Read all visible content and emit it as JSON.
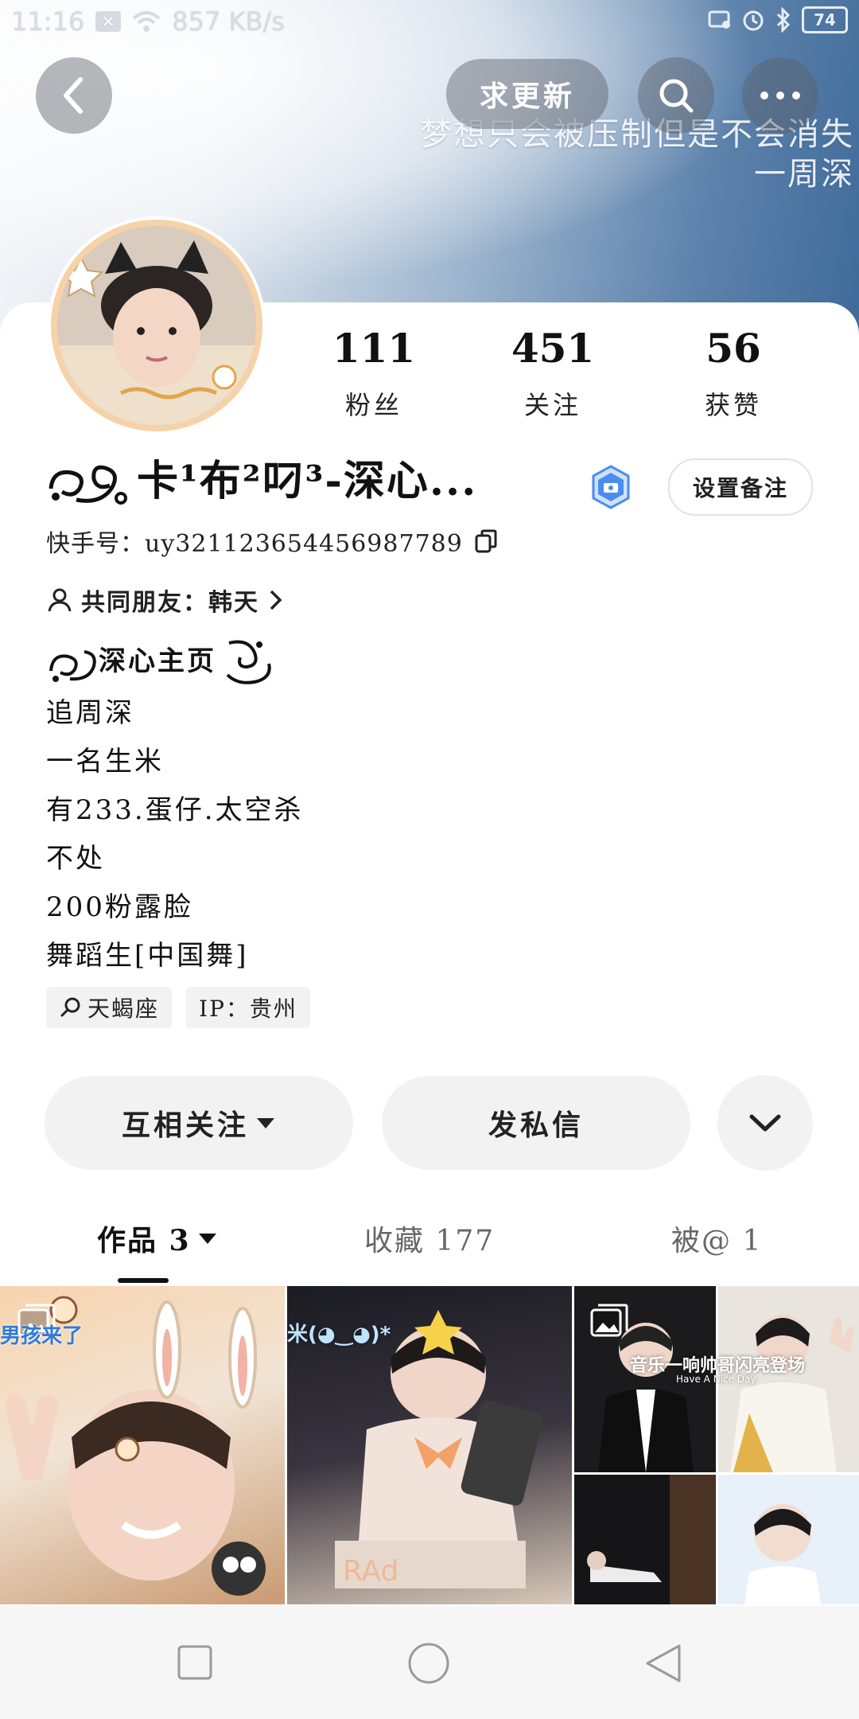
{
  "status_bar": {
    "time": "11:16",
    "speed": "857 KB/s",
    "battery": "74"
  },
  "header": {
    "follow_request_label": "求更新",
    "quote_line1": "梦想只会被压制但是不会消失",
    "quote_line2": "一周深"
  },
  "profile": {
    "stats": [
      {
        "value": "111",
        "label": "粉丝"
      },
      {
        "value": "451",
        "label": "关注"
      },
      {
        "value": "56",
        "label": "获赞"
      }
    ],
    "name": "卡¹布²叼³-深心...",
    "remark_label": "设置备注",
    "kuaishou_id": "快手号：uy3211236544569877​89",
    "mutual_friends": "共同朋友：韩天",
    "bio_header": "深心主页",
    "bio_lines": [
      "追周深",
      "一名生米",
      "有233.蛋仔.太空杀",
      "不处",
      "200粉露脸",
      "舞蹈生[中国舞]"
    ],
    "tags": [
      "天蝎座",
      "IP：贵州"
    ]
  },
  "actions": {
    "follow_label": "互相关注",
    "message_label": "发私信"
  },
  "tabs": [
    {
      "label": "作品 3",
      "active": true
    },
    {
      "label": "收藏 177",
      "active": false
    },
    {
      "label": "被@ 1",
      "active": false
    }
  ],
  "grid": {
    "tile1_caption": "男孩来了",
    "tile2_caption": "米(◕‿◕)*",
    "tile3_caption": "音乐一响帅哥闪亮登场",
    "tile3_sub": "Have A Nice Day"
  },
  "icons": {
    "back": "back-icon",
    "search": "search-icon",
    "more": "more-icon",
    "copy": "copy-icon",
    "person": "person-icon",
    "chevron_right": "chevron-right-icon",
    "search_tag": "search-tag-icon",
    "chevron_down": "chevron-down-icon",
    "caret_down": "caret-down-icon",
    "verified": "verified-badge-icon",
    "image": "image-icon"
  },
  "colors": {
    "accent": "#111111",
    "button_bg": "#f2f2f2",
    "verified": "#4a8df0",
    "avatar_ring": "#f6d2a8"
  }
}
